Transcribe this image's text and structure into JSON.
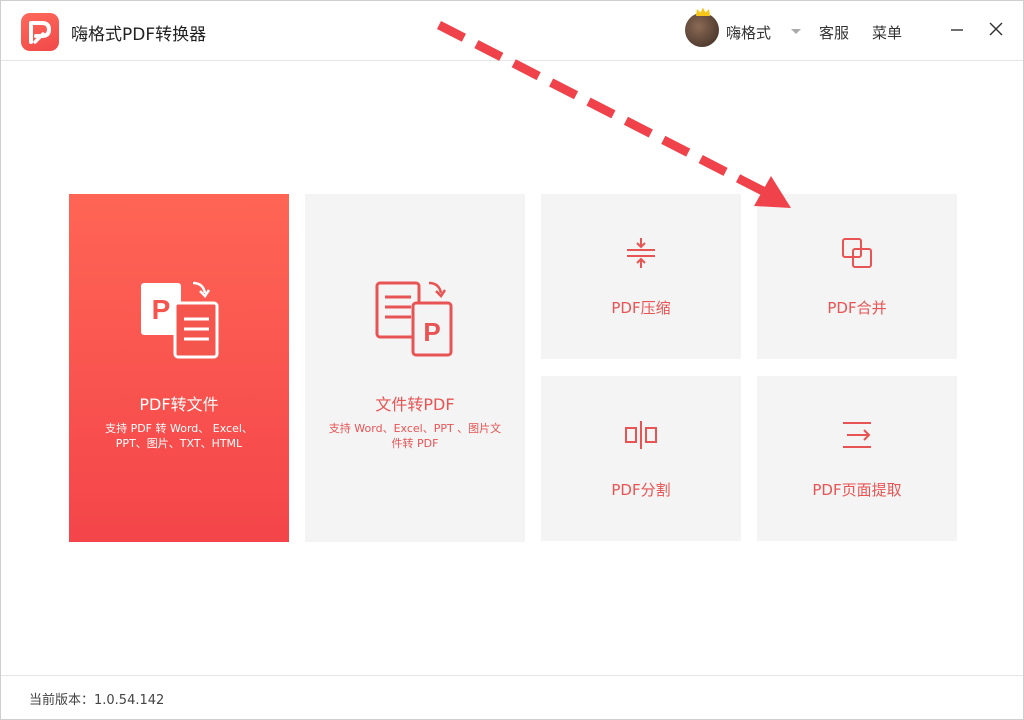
{
  "titlebar": {
    "app_title": "嗨格式PDF转换器",
    "username": "嗨格式",
    "service": "客服",
    "menu": "菜单"
  },
  "cards": {
    "pdf_to_file": {
      "title": "PDF转文件",
      "desc": "支持 PDF 转 Word、 Excel、 PPT、图片、TXT、HTML"
    },
    "file_to_pdf": {
      "title": "文件转PDF",
      "desc": "支持 Word、Excel、PPT 、图片文件转 PDF"
    },
    "compress": {
      "title": "PDF压缩"
    },
    "merge": {
      "title": "PDF合并"
    },
    "split": {
      "title": "PDF分割"
    },
    "extract": {
      "title": "PDF页面提取"
    }
  },
  "footer": {
    "version": "当前版本：1.0.54.142"
  },
  "colors": {
    "accent": "#e85454",
    "primary_card_top": "#ff6555",
    "primary_card_bottom": "#f4454a",
    "card_bg": "#f4f4f4",
    "annotation_arrow": "#f0424a"
  }
}
